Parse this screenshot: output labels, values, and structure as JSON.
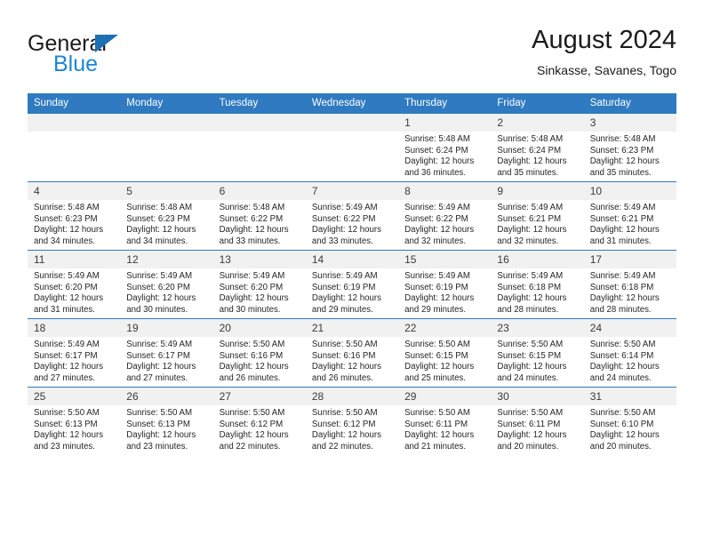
{
  "brand": {
    "name_top": "General",
    "name_bottom": "Blue",
    "triangle_color": "#1f6fb5",
    "blue_color": "#1b86d4"
  },
  "header": {
    "title": "August 2024",
    "subtitle": "Sinkasse, Savanes, Togo"
  },
  "theme": {
    "header_bar_color": "#2f7ac0",
    "daynum_band_color": "#f1f1f1",
    "text_color": "#262626"
  },
  "weekdays": [
    "Sunday",
    "Monday",
    "Tuesday",
    "Wednesday",
    "Thursday",
    "Friday",
    "Saturday"
  ],
  "weeks": [
    [
      {
        "day": "",
        "empty": true,
        "l1": "",
        "l2": "",
        "l3": "",
        "l4": ""
      },
      {
        "day": "",
        "empty": true,
        "l1": "",
        "l2": "",
        "l3": "",
        "l4": ""
      },
      {
        "day": "",
        "empty": true,
        "l1": "",
        "l2": "",
        "l3": "",
        "l4": ""
      },
      {
        "day": "",
        "empty": true,
        "l1": "",
        "l2": "",
        "l3": "",
        "l4": ""
      },
      {
        "day": "1",
        "l1": "Sunrise: 5:48 AM",
        "l2": "Sunset: 6:24 PM",
        "l3": "Daylight: 12 hours",
        "l4": "and 36 minutes."
      },
      {
        "day": "2",
        "l1": "Sunrise: 5:48 AM",
        "l2": "Sunset: 6:24 PM",
        "l3": "Daylight: 12 hours",
        "l4": "and 35 minutes."
      },
      {
        "day": "3",
        "l1": "Sunrise: 5:48 AM",
        "l2": "Sunset: 6:23 PM",
        "l3": "Daylight: 12 hours",
        "l4": "and 35 minutes."
      }
    ],
    [
      {
        "day": "4",
        "l1": "Sunrise: 5:48 AM",
        "l2": "Sunset: 6:23 PM",
        "l3": "Daylight: 12 hours",
        "l4": "and 34 minutes."
      },
      {
        "day": "5",
        "l1": "Sunrise: 5:48 AM",
        "l2": "Sunset: 6:23 PM",
        "l3": "Daylight: 12 hours",
        "l4": "and 34 minutes."
      },
      {
        "day": "6",
        "l1": "Sunrise: 5:48 AM",
        "l2": "Sunset: 6:22 PM",
        "l3": "Daylight: 12 hours",
        "l4": "and 33 minutes."
      },
      {
        "day": "7",
        "l1": "Sunrise: 5:49 AM",
        "l2": "Sunset: 6:22 PM",
        "l3": "Daylight: 12 hours",
        "l4": "and 33 minutes."
      },
      {
        "day": "8",
        "l1": "Sunrise: 5:49 AM",
        "l2": "Sunset: 6:22 PM",
        "l3": "Daylight: 12 hours",
        "l4": "and 32 minutes."
      },
      {
        "day": "9",
        "l1": "Sunrise: 5:49 AM",
        "l2": "Sunset: 6:21 PM",
        "l3": "Daylight: 12 hours",
        "l4": "and 32 minutes."
      },
      {
        "day": "10",
        "l1": "Sunrise: 5:49 AM",
        "l2": "Sunset: 6:21 PM",
        "l3": "Daylight: 12 hours",
        "l4": "and 31 minutes."
      }
    ],
    [
      {
        "day": "11",
        "l1": "Sunrise: 5:49 AM",
        "l2": "Sunset: 6:20 PM",
        "l3": "Daylight: 12 hours",
        "l4": "and 31 minutes."
      },
      {
        "day": "12",
        "l1": "Sunrise: 5:49 AM",
        "l2": "Sunset: 6:20 PM",
        "l3": "Daylight: 12 hours",
        "l4": "and 30 minutes."
      },
      {
        "day": "13",
        "l1": "Sunrise: 5:49 AM",
        "l2": "Sunset: 6:20 PM",
        "l3": "Daylight: 12 hours",
        "l4": "and 30 minutes."
      },
      {
        "day": "14",
        "l1": "Sunrise: 5:49 AM",
        "l2": "Sunset: 6:19 PM",
        "l3": "Daylight: 12 hours",
        "l4": "and 29 minutes."
      },
      {
        "day": "15",
        "l1": "Sunrise: 5:49 AM",
        "l2": "Sunset: 6:19 PM",
        "l3": "Daylight: 12 hours",
        "l4": "and 29 minutes."
      },
      {
        "day": "16",
        "l1": "Sunrise: 5:49 AM",
        "l2": "Sunset: 6:18 PM",
        "l3": "Daylight: 12 hours",
        "l4": "and 28 minutes."
      },
      {
        "day": "17",
        "l1": "Sunrise: 5:49 AM",
        "l2": "Sunset: 6:18 PM",
        "l3": "Daylight: 12 hours",
        "l4": "and 28 minutes."
      }
    ],
    [
      {
        "day": "18",
        "l1": "Sunrise: 5:49 AM",
        "l2": "Sunset: 6:17 PM",
        "l3": "Daylight: 12 hours",
        "l4": "and 27 minutes."
      },
      {
        "day": "19",
        "l1": "Sunrise: 5:49 AM",
        "l2": "Sunset: 6:17 PM",
        "l3": "Daylight: 12 hours",
        "l4": "and 27 minutes."
      },
      {
        "day": "20",
        "l1": "Sunrise: 5:50 AM",
        "l2": "Sunset: 6:16 PM",
        "l3": "Daylight: 12 hours",
        "l4": "and 26 minutes."
      },
      {
        "day": "21",
        "l1": "Sunrise: 5:50 AM",
        "l2": "Sunset: 6:16 PM",
        "l3": "Daylight: 12 hours",
        "l4": "and 26 minutes."
      },
      {
        "day": "22",
        "l1": "Sunrise: 5:50 AM",
        "l2": "Sunset: 6:15 PM",
        "l3": "Daylight: 12 hours",
        "l4": "and 25 minutes."
      },
      {
        "day": "23",
        "l1": "Sunrise: 5:50 AM",
        "l2": "Sunset: 6:15 PM",
        "l3": "Daylight: 12 hours",
        "l4": "and 24 minutes."
      },
      {
        "day": "24",
        "l1": "Sunrise: 5:50 AM",
        "l2": "Sunset: 6:14 PM",
        "l3": "Daylight: 12 hours",
        "l4": "and 24 minutes."
      }
    ],
    [
      {
        "day": "25",
        "l1": "Sunrise: 5:50 AM",
        "l2": "Sunset: 6:13 PM",
        "l3": "Daylight: 12 hours",
        "l4": "and 23 minutes."
      },
      {
        "day": "26",
        "l1": "Sunrise: 5:50 AM",
        "l2": "Sunset: 6:13 PM",
        "l3": "Daylight: 12 hours",
        "l4": "and 23 minutes."
      },
      {
        "day": "27",
        "l1": "Sunrise: 5:50 AM",
        "l2": "Sunset: 6:12 PM",
        "l3": "Daylight: 12 hours",
        "l4": "and 22 minutes."
      },
      {
        "day": "28",
        "l1": "Sunrise: 5:50 AM",
        "l2": "Sunset: 6:12 PM",
        "l3": "Daylight: 12 hours",
        "l4": "and 22 minutes."
      },
      {
        "day": "29",
        "l1": "Sunrise: 5:50 AM",
        "l2": "Sunset: 6:11 PM",
        "l3": "Daylight: 12 hours",
        "l4": "and 21 minutes."
      },
      {
        "day": "30",
        "l1": "Sunrise: 5:50 AM",
        "l2": "Sunset: 6:11 PM",
        "l3": "Daylight: 12 hours",
        "l4": "and 20 minutes."
      },
      {
        "day": "31",
        "l1": "Sunrise: 5:50 AM",
        "l2": "Sunset: 6:10 PM",
        "l3": "Daylight: 12 hours",
        "l4": "and 20 minutes."
      }
    ]
  ]
}
